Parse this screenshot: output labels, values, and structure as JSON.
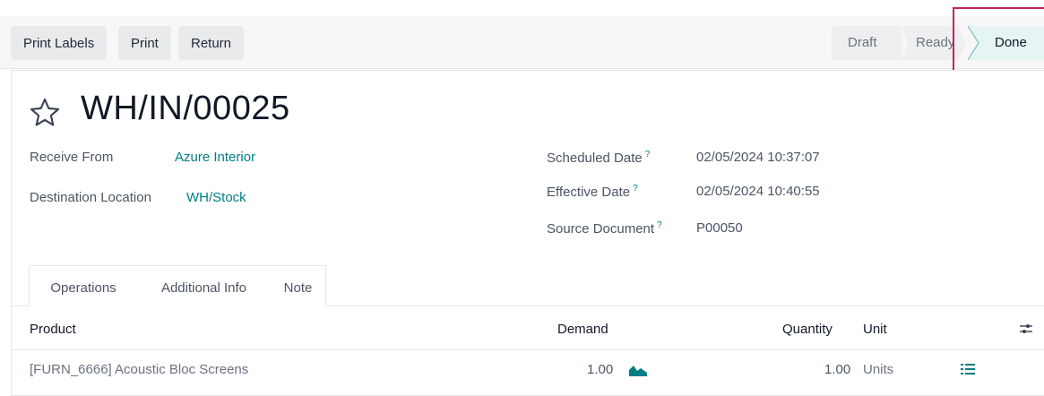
{
  "toolbar": {
    "print_labels": "Print Labels",
    "print": "Print",
    "return": "Return"
  },
  "status_bar": {
    "stages": [
      "Draft",
      "Ready",
      "Done"
    ],
    "current": "Done"
  },
  "record": {
    "title": "WH/IN/00025",
    "receive_from_label": "Receive From",
    "receive_from_value": "Azure Interior",
    "destination_label": "Destination Location",
    "destination_value": "WH/Stock",
    "scheduled_date_label": "Scheduled Date",
    "scheduled_date_value": "02/05/2024 10:37:07",
    "effective_date_label": "Effective Date",
    "effective_date_value": "02/05/2024 10:40:55",
    "source_document_label": "Source Document",
    "source_document_value": "P00050",
    "help_mark": "?"
  },
  "tabs": [
    "Operations",
    "Additional Info",
    "Note"
  ],
  "table": {
    "columns": {
      "product": "Product",
      "demand": "Demand",
      "quantity": "Quantity",
      "unit": "Unit"
    },
    "rows": [
      {
        "product": "[FURN_6666] Acoustic Bloc Screens",
        "demand": "1.00",
        "quantity": "1.00",
        "unit": "Units"
      }
    ]
  },
  "colors": {
    "accent": "#017e84",
    "highlight": "#c2255c"
  },
  "icons": [
    "star-icon",
    "forecast-chart-icon",
    "details-list-icon",
    "column-settings-icon"
  ]
}
